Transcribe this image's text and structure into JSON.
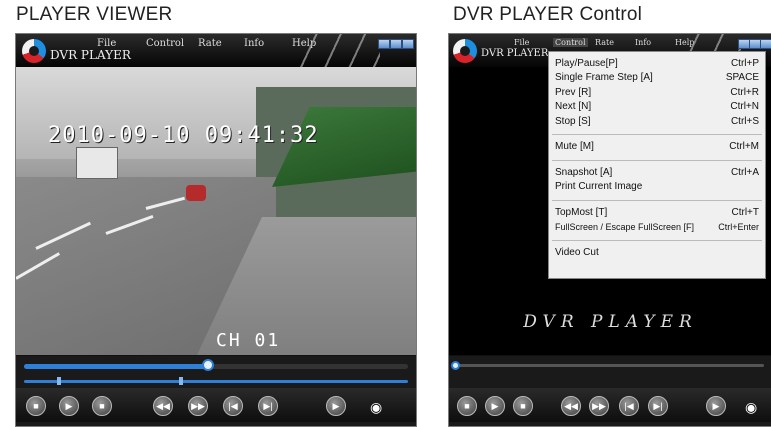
{
  "captions": {
    "left": "PLAYER VIEWER",
    "right": "DVR PLAYER Control"
  },
  "left_player": {
    "app_title": "DVR PLAYER",
    "menu": [
      "File",
      "Control",
      "Rate",
      "Info",
      "Help"
    ],
    "timestamp": "2010-09-10 09:41:32",
    "channel": "CH 01",
    "progress_fraction": 0.48
  },
  "right_player": {
    "app_title": "DVR PLAYER",
    "menu": [
      "File",
      "Control",
      "Rate",
      "Info",
      "Help"
    ],
    "logo_text": "DVR PLAYER",
    "progress_fraction": 0.0,
    "dropdown": [
      {
        "label": "Play/Pause[P]",
        "shortcut": "Ctrl+P"
      },
      {
        "label": "Single Frame Step [A]",
        "shortcut": "SPACE"
      },
      {
        "label": "Prev [R]",
        "shortcut": "Ctrl+R"
      },
      {
        "label": "Next [N]",
        "shortcut": "Ctrl+N"
      },
      {
        "label": "Stop [S]",
        "shortcut": "Ctrl+S"
      },
      {
        "label": "Mute [M]",
        "shortcut": "Ctrl+M"
      },
      {
        "label": "Snapshot [A]",
        "shortcut": "Ctrl+A"
      },
      {
        "label": "Print Current Image",
        "shortcut": ""
      },
      {
        "label": "TopMost [T]",
        "shortcut": "Ctrl+T"
      },
      {
        "label": "FullScreen / Escape FullScreen [F]",
        "shortcut": "Ctrl+Enter"
      },
      {
        "label": "Video Cut",
        "shortcut": ""
      }
    ]
  },
  "buttons": [
    "stop-icon",
    "play-icon",
    "pause-icon",
    "rewind-icon",
    "fast-forward-icon",
    "prev-icon",
    "next-icon",
    "step-icon",
    "camera-icon"
  ],
  "colors": {
    "accent": "#2d7fd8",
    "menu_bg": "#f0f0f0"
  }
}
